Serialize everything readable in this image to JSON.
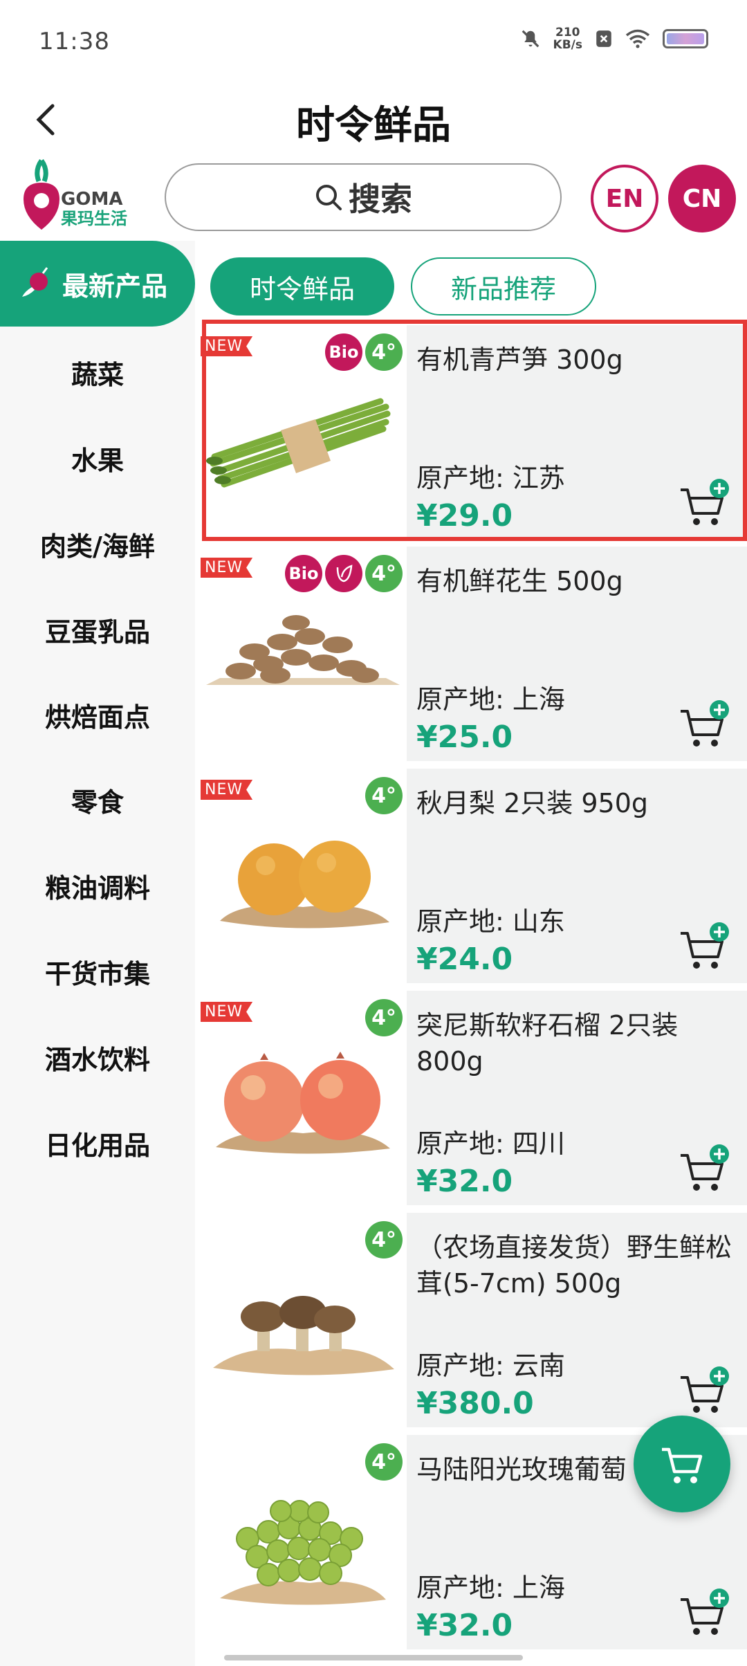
{
  "status_bar": {
    "time": "11:38",
    "net_speed_value": "210",
    "net_speed_unit": "KB/s"
  },
  "header": {
    "title": "时令鲜品"
  },
  "logo": {
    "brand_en": "GOMA",
    "brand_cn": "果玛生活"
  },
  "search": {
    "label": "搜索"
  },
  "language": {
    "en": "EN",
    "cn": "CN"
  },
  "sidebar": {
    "active": "最新产品",
    "items": [
      "蔬菜",
      "水果",
      "肉类/海鲜",
      "豆蛋乳品",
      "烘焙面点",
      "零食",
      "粮油调料",
      "干货市集",
      "酒水饮料",
      "日化用品"
    ]
  },
  "tabs": [
    {
      "label": "时令鲜品",
      "active": true
    },
    {
      "label": "新品推荐",
      "active": false
    }
  ],
  "badges": {
    "new": "NEW",
    "bio": "Bio",
    "temp": "4°"
  },
  "products": [
    {
      "name": "有机青芦笋 300g",
      "origin": "原产地: 江苏",
      "price": "¥29.0",
      "new": true,
      "bio": true,
      "veg": false,
      "image": "asparagus"
    },
    {
      "name": "有机鲜花生 500g",
      "origin": "原产地: 上海",
      "price": "¥25.0",
      "new": true,
      "bio": true,
      "veg": true,
      "image": "peanuts"
    },
    {
      "name": "秋月梨 2只装 950g",
      "origin": "原产地: 山东",
      "price": "¥24.0",
      "new": true,
      "bio": false,
      "veg": false,
      "image": "pears"
    },
    {
      "name": "突尼斯软籽石榴 2只装 800g",
      "origin": "原产地: 四川",
      "price": "¥32.0",
      "new": true,
      "bio": false,
      "veg": false,
      "image": "pomegranates"
    },
    {
      "name": "（农场直接发货）野生鲜松茸(5-7cm) 500g",
      "origin": "原产地: 云南",
      "price": "¥380.0",
      "new": false,
      "bio": false,
      "veg": false,
      "image": "mushrooms"
    },
    {
      "name": "马陆阳光玫瑰葡萄",
      "origin": "原产地: 上海",
      "price": "¥32.0",
      "new": false,
      "bio": false,
      "veg": false,
      "image": "grapes"
    }
  ],
  "colors": {
    "brand_green": "#16a37a",
    "brand_magenta": "#c2185b",
    "highlight_red": "#e53935"
  }
}
